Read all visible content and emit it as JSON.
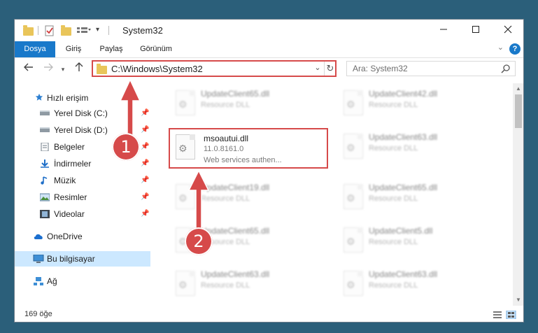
{
  "window": {
    "title": "System32"
  },
  "ribbon": {
    "tabs": [
      {
        "label": "Dosya"
      },
      {
        "label": "Giriş"
      },
      {
        "label": "Paylaş"
      },
      {
        "label": "Görünüm"
      }
    ],
    "help_label": "?"
  },
  "nav": {
    "address": "C:\\Windows\\System32",
    "search_placeholder": "Ara: System32"
  },
  "sidebar": {
    "items": [
      {
        "label": "Hızlı erişim",
        "icon": "star-icon"
      },
      {
        "label": "Yerel Disk (C:)",
        "icon": "drive-icon",
        "pinned": true
      },
      {
        "label": "Yerel Disk (D:)",
        "icon": "drive-icon",
        "pinned": true
      },
      {
        "label": "Belgeler",
        "icon": "documents-icon",
        "pinned": true
      },
      {
        "label": "İndirmeler",
        "icon": "download-icon",
        "pinned": true
      },
      {
        "label": "Müzik",
        "icon": "music-icon",
        "pinned": true
      },
      {
        "label": "Resimler",
        "icon": "pictures-icon",
        "pinned": true
      },
      {
        "label": "Videolar",
        "icon": "videos-icon",
        "pinned": true
      },
      {
        "label": "OneDrive",
        "icon": "cloud-icon"
      },
      {
        "label": "Bu bilgisayar",
        "icon": "computer-icon",
        "selected": true
      },
      {
        "label": "Ağ",
        "icon": "network-icon"
      }
    ]
  },
  "files": {
    "left": [
      {
        "name": "UpdateClient65.dll",
        "type": "Resource DLL"
      },
      {
        "name": "msoautui.dll",
        "version": "11.0.8161.0",
        "description": "Web services authen..."
      },
      {
        "name": "UpdateClient19.dll",
        "type": "Resource DLL"
      },
      {
        "name": "UpdateClient65.dll",
        "type": "Resource DLL"
      },
      {
        "name": "UpdateClient63.dll",
        "type": "Resource DLL"
      }
    ],
    "right": [
      {
        "name": "UpdateClient42.dll",
        "type": "Resource DLL"
      },
      {
        "name": "UpdateClient63.dll",
        "type": "Resource DLL"
      },
      {
        "name": "UpdateClient65.dll",
        "type": "Resource DLL"
      },
      {
        "name": "UpdateClient5.dll",
        "type": "Resource DLL"
      },
      {
        "name": "UpdateClient63.dll",
        "type": "Resource DLL"
      }
    ]
  },
  "status": {
    "count": "169 öğe"
  },
  "annotations": {
    "step1": "1",
    "step2": "2"
  },
  "colors": {
    "accent": "#1979ca",
    "highlight": "#d64a4a",
    "selection": "#cce8ff"
  }
}
